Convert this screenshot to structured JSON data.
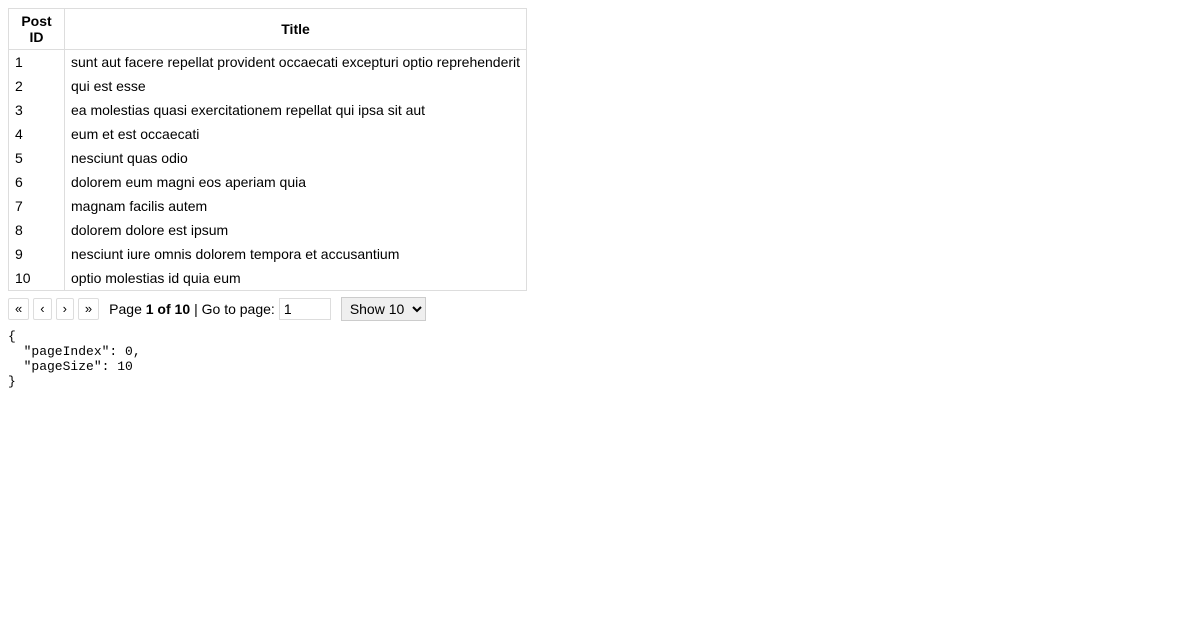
{
  "table": {
    "columns": [
      "Post ID",
      "Title"
    ],
    "rows": [
      {
        "id": "1",
        "title": "sunt aut facere repellat provident occaecati excepturi optio reprehenderit"
      },
      {
        "id": "2",
        "title": "qui est esse"
      },
      {
        "id": "3",
        "title": "ea molestias quasi exercitationem repellat qui ipsa sit aut"
      },
      {
        "id": "4",
        "title": "eum et est occaecati"
      },
      {
        "id": "5",
        "title": "nesciunt quas odio"
      },
      {
        "id": "6",
        "title": "dolorem eum magni eos aperiam quia"
      },
      {
        "id": "7",
        "title": "magnam facilis autem"
      },
      {
        "id": "8",
        "title": "dolorem dolore est ipsum"
      },
      {
        "id": "9",
        "title": "nesciunt iure omnis dolorem tempora et accusantium"
      },
      {
        "id": "10",
        "title": "optio molestias id quia eum"
      }
    ]
  },
  "pagination": {
    "first_label": "«",
    "prev_label": "‹",
    "next_label": "›",
    "last_label": "»",
    "page_prefix": "Page ",
    "page_status": "1 of 10",
    "goto_label": " | Go to page: ",
    "goto_value": "1",
    "show_label": "Show 10"
  },
  "debug": {
    "text": "{\n  \"pageIndex\": 0,\n  \"pageSize\": 10\n}"
  }
}
